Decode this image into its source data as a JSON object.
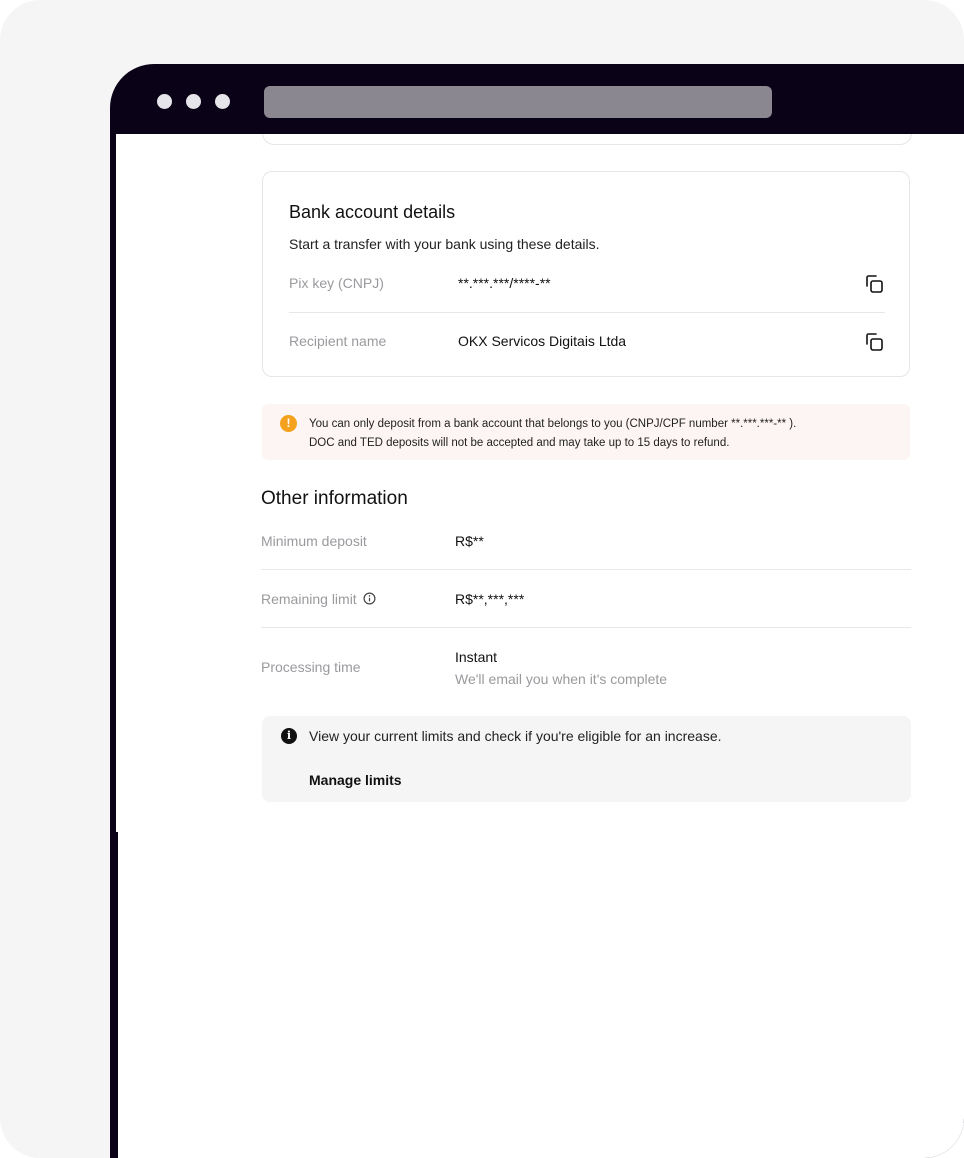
{
  "bank_card": {
    "title": "Bank account details",
    "subtitle": "Start a transfer with your bank using these details.",
    "rows": [
      {
        "label": "Pix key (CNPJ)",
        "value": "**.***.***/****-**"
      },
      {
        "label": "Recipient name",
        "value": "OKX Servicos Digitais Ltda"
      }
    ],
    "copy_icon": "copy-icon"
  },
  "warning": {
    "icon": "exclamation-icon",
    "line1": "You can only deposit from a bank account that belongs to you (CNPJ/CPF number  **.***.***-** ).",
    "line2": "DOC and TED deposits will not be accepted and may take up to 15 days to refund."
  },
  "other_info": {
    "title": "Other information",
    "rows": [
      {
        "label": "Minimum deposit",
        "value": "R$**"
      },
      {
        "label": "Remaining limit",
        "value": "R$**,***,***"
      },
      {
        "label": "Processing time",
        "value": "Instant",
        "sub": "We'll email you when it's complete"
      }
    ]
  },
  "limits_box": {
    "icon": "info-icon",
    "text": "View your current limits and check if you're eligible for an increase.",
    "link": "Manage limits"
  },
  "colors": {
    "warning": "#f4a21d",
    "warning_bg": "#fdf5f3",
    "frame": "#0a0318"
  }
}
